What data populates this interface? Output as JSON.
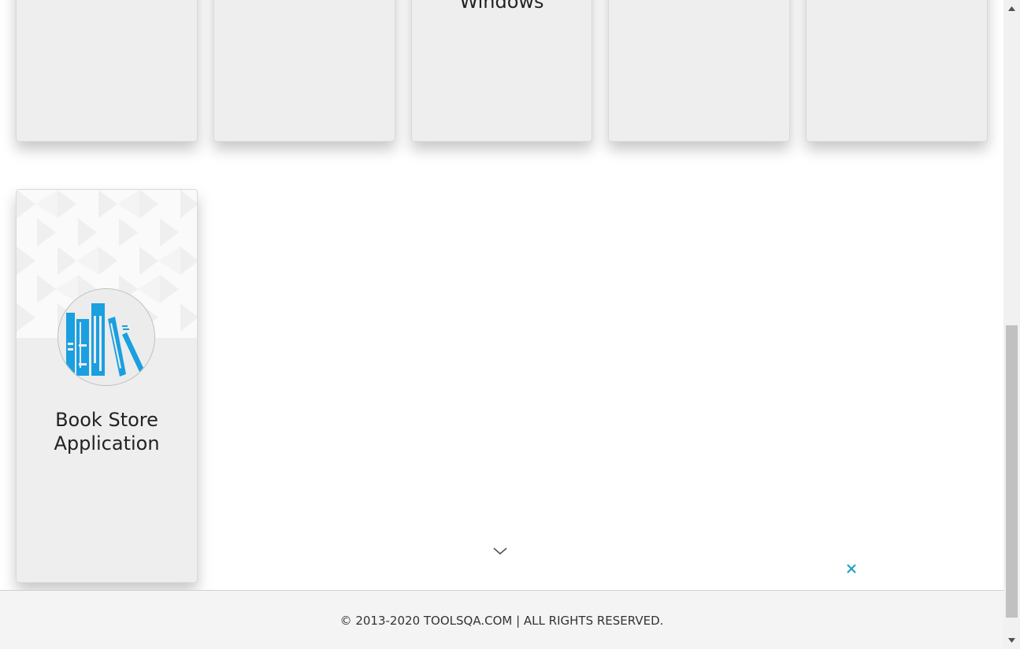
{
  "cards_row1": [
    {
      "title": ""
    },
    {
      "title": ""
    },
    {
      "title": "Windows"
    },
    {
      "title": ""
    },
    {
      "title": ""
    }
  ],
  "book_store": {
    "title_line1": "Book Store",
    "title_line2": "Application",
    "icon": "books-icon"
  },
  "ad": {
    "expand_icon": "chevron-down-icon",
    "close_icon": "close-icon",
    "close_color": "#1aa0c4"
  },
  "footer": {
    "text": "© 2013-2020 TOOLSQA.COM | ALL RIGHTS RESERVED."
  },
  "colors": {
    "card_bg": "#eeeeee",
    "accent_blue": "#1a9fe0",
    "footer_bg": "#f4f4f4"
  }
}
